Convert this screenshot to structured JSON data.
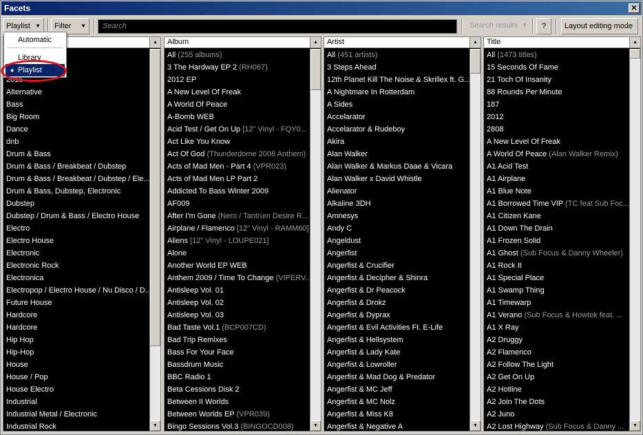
{
  "window": {
    "title": "Facets",
    "close_label": "✕"
  },
  "toolbar": {
    "playlist_label": "Playlist",
    "filter_label": "Filter",
    "search_placeholder": "Search",
    "search_results_label": "Search results",
    "help_label": "?",
    "layout_mode_label": "Layout editing mode"
  },
  "dropdown": {
    "items": [
      {
        "label": "Automatic",
        "selected": false
      },
      {
        "label": "Library",
        "selected": false
      },
      {
        "label": "Playlist",
        "selected": true
      }
    ]
  },
  "columns": [
    {
      "header": "",
      "rows": [
        {
          "text": ""
        },
        {
          "text": ""
        },
        {
          "text": "2015"
        },
        {
          "text": "Alternative"
        },
        {
          "text": "Bass"
        },
        {
          "text": "Big Room"
        },
        {
          "text": "Dance"
        },
        {
          "text": "dnb"
        },
        {
          "text": "Drum & Bass"
        },
        {
          "text": "Drum & Bass / Breakbeat / Dubstep"
        },
        {
          "text": "Drum & Bass / Breakbeat / Dubstep / Ele..."
        },
        {
          "text": "Drum & Bass, Dubstep, Electronic"
        },
        {
          "text": "Dubstep"
        },
        {
          "text": "Dubstep / Drum & Bass / Electro House"
        },
        {
          "text": "Electro"
        },
        {
          "text": "Electro House"
        },
        {
          "text": "Electronic"
        },
        {
          "text": "Electronic Rock"
        },
        {
          "text": "Electronica"
        },
        {
          "text": "Electropop / Electro House / Nu Disco / D..."
        },
        {
          "text": "Future House"
        },
        {
          "text": "Hardcore"
        },
        {
          "text": "Hardcore"
        },
        {
          "text": "Hip Hop"
        },
        {
          "text": "Hip-Hop"
        },
        {
          "text": "House"
        },
        {
          "text": "House / Pop"
        },
        {
          "text": "House Electro"
        },
        {
          "text": "Industrial"
        },
        {
          "text": "Industrial Metal / Electronic"
        },
        {
          "text": "Industrial Rock"
        }
      ]
    },
    {
      "header": "Album",
      "rows": [
        {
          "text": "All",
          "sub": " (255 albums)"
        },
        {
          "text": "3 The Hardway EP 2",
          "sub": " (RH067)"
        },
        {
          "text": "2012 EP"
        },
        {
          "text": "A New Level Of Freak"
        },
        {
          "text": "A World Of Peace"
        },
        {
          "text": "A-Bomb WEB"
        },
        {
          "text": "Acid Test / Get On Up",
          "sub": " [12\" Vinyl - FQY0..."
        },
        {
          "text": "Act Like You Know"
        },
        {
          "text": "Act Of God",
          "sub": " (Thunderdome 2008 Anthem)"
        },
        {
          "text": "Acts of Mad Men - Part 4",
          "sub": " (VPR023)"
        },
        {
          "text": "Acts of Mad Men LP Part 2"
        },
        {
          "text": "Addicted To Bass Winter 2009"
        },
        {
          "text": "AF009"
        },
        {
          "text": "After I'm Gone",
          "sub": " (Nero / Tantrum Desire R..."
        },
        {
          "text": "Airplane / Flamenco",
          "sub": " [12\" Vinyl - RAMM60]"
        },
        {
          "text": "Aliens",
          "sub": " [12\" Vinyl - LOUPE021]"
        },
        {
          "text": "Alone"
        },
        {
          "text": "Another World EP WEB"
        },
        {
          "text": "Anthem 2009 / Time To Change",
          "sub": " (VIPERV..."
        },
        {
          "text": "Antisleep Vol. 01"
        },
        {
          "text": "Antisleep Vol. 02"
        },
        {
          "text": "Antisleep Vol. 03"
        },
        {
          "text": "Bad Taste Vol.1",
          "sub": " (BCP007CD)"
        },
        {
          "text": "Bad Trip Remixes"
        },
        {
          "text": "Bass For Your Face"
        },
        {
          "text": "Bassdrum Music"
        },
        {
          "text": "BBC Radio 1"
        },
        {
          "text": "Beta Cessions Disk 2"
        },
        {
          "text": "Between II Worlds"
        },
        {
          "text": "Between Worlds EP",
          "sub": " (VPR039)"
        },
        {
          "text": "Bingo Sessions Vol.3",
          "sub": " (BINGOCD008)"
        }
      ]
    },
    {
      "header": "Artist",
      "rows": [
        {
          "text": "All",
          "sub": " (451 artists)"
        },
        {
          "text": "3 Steps Ahead"
        },
        {
          "text": "12th Planet Kill The Noise & Skrillex ft. G..."
        },
        {
          "text": "A Nightmare In Rotterdam"
        },
        {
          "text": "A Sides"
        },
        {
          "text": "Accelarator"
        },
        {
          "text": "Accelarator & Rudeboy"
        },
        {
          "text": "Akira"
        },
        {
          "text": "Alan Walker"
        },
        {
          "text": "Alan Walker & Markus Daae & Vicara"
        },
        {
          "text": "Alan Walker x David Whistle"
        },
        {
          "text": "Alienator"
        },
        {
          "text": "Alkaline 3DH"
        },
        {
          "text": "Amnesys"
        },
        {
          "text": "Andy C"
        },
        {
          "text": "Angeldust"
        },
        {
          "text": "Angerfist"
        },
        {
          "text": "Angerfist & Crucifier"
        },
        {
          "text": "Angerfist & Decipher & Shinra"
        },
        {
          "text": "Angerfist & Dr Peacock"
        },
        {
          "text": "Angerfist & Drokz"
        },
        {
          "text": "Angerfist & Dyprax"
        },
        {
          "text": "Angerfist & Evil Activities Ft. E-Life"
        },
        {
          "text": "Angerfist & Hellsystem"
        },
        {
          "text": "Angerfist & Lady Kate"
        },
        {
          "text": "Angerfist & Lowroller"
        },
        {
          "text": "Angerfist & Mad Dog & Predator"
        },
        {
          "text": "Angerfist & MC Jeff"
        },
        {
          "text": "Angerfist & MC Nolz"
        },
        {
          "text": "Angerfist & Miss K8"
        },
        {
          "text": "Angerfist & Negative A"
        }
      ]
    },
    {
      "header": "Title",
      "rows": [
        {
          "text": "All",
          "sub": " (1473 titles)"
        },
        {
          "text": "15 Seconds Of Fame"
        },
        {
          "text": "21 Toch Of Insanity"
        },
        {
          "text": "88 Rounds Per Minute"
        },
        {
          "text": "187"
        },
        {
          "text": "2012"
        },
        {
          "text": "2808"
        },
        {
          "text": "A New Level Of Freak"
        },
        {
          "text": "A World Of Peace",
          "sub": " (Alan Walker Remix)"
        },
        {
          "text": "A1 Acid Test"
        },
        {
          "text": "A1 Airplane"
        },
        {
          "text": "A1 Blue Note"
        },
        {
          "text": "A1 Borrowed Time VIP",
          "sub": " (TC feat Sub Foc..."
        },
        {
          "text": "A1 Citizen Kane"
        },
        {
          "text": "A1 Down The Drain"
        },
        {
          "text": "A1 Frozen Solid"
        },
        {
          "text": "A1 Ghost",
          "sub": " (Sub Focus & Danny Wheeler)"
        },
        {
          "text": "A1 Rock It"
        },
        {
          "text": "A1 Special Place"
        },
        {
          "text": "A1 Swamp Thing"
        },
        {
          "text": "A1 Timewarp"
        },
        {
          "text": "A1 Verano",
          "sub": " (Sub Focus & Howtek feat. ..."
        },
        {
          "text": "A1 X Ray"
        },
        {
          "text": "A2 Druggy"
        },
        {
          "text": "A2 Flamenco"
        },
        {
          "text": "A2 Follow The Light"
        },
        {
          "text": "A2 Get On Up"
        },
        {
          "text": "A2 Hotline"
        },
        {
          "text": "A2 Join The Dots"
        },
        {
          "text": "A2 Juno"
        },
        {
          "text": "A2 Lost Highway",
          "sub": " (Sub Focus & Danny ..."
        }
      ]
    }
  ]
}
